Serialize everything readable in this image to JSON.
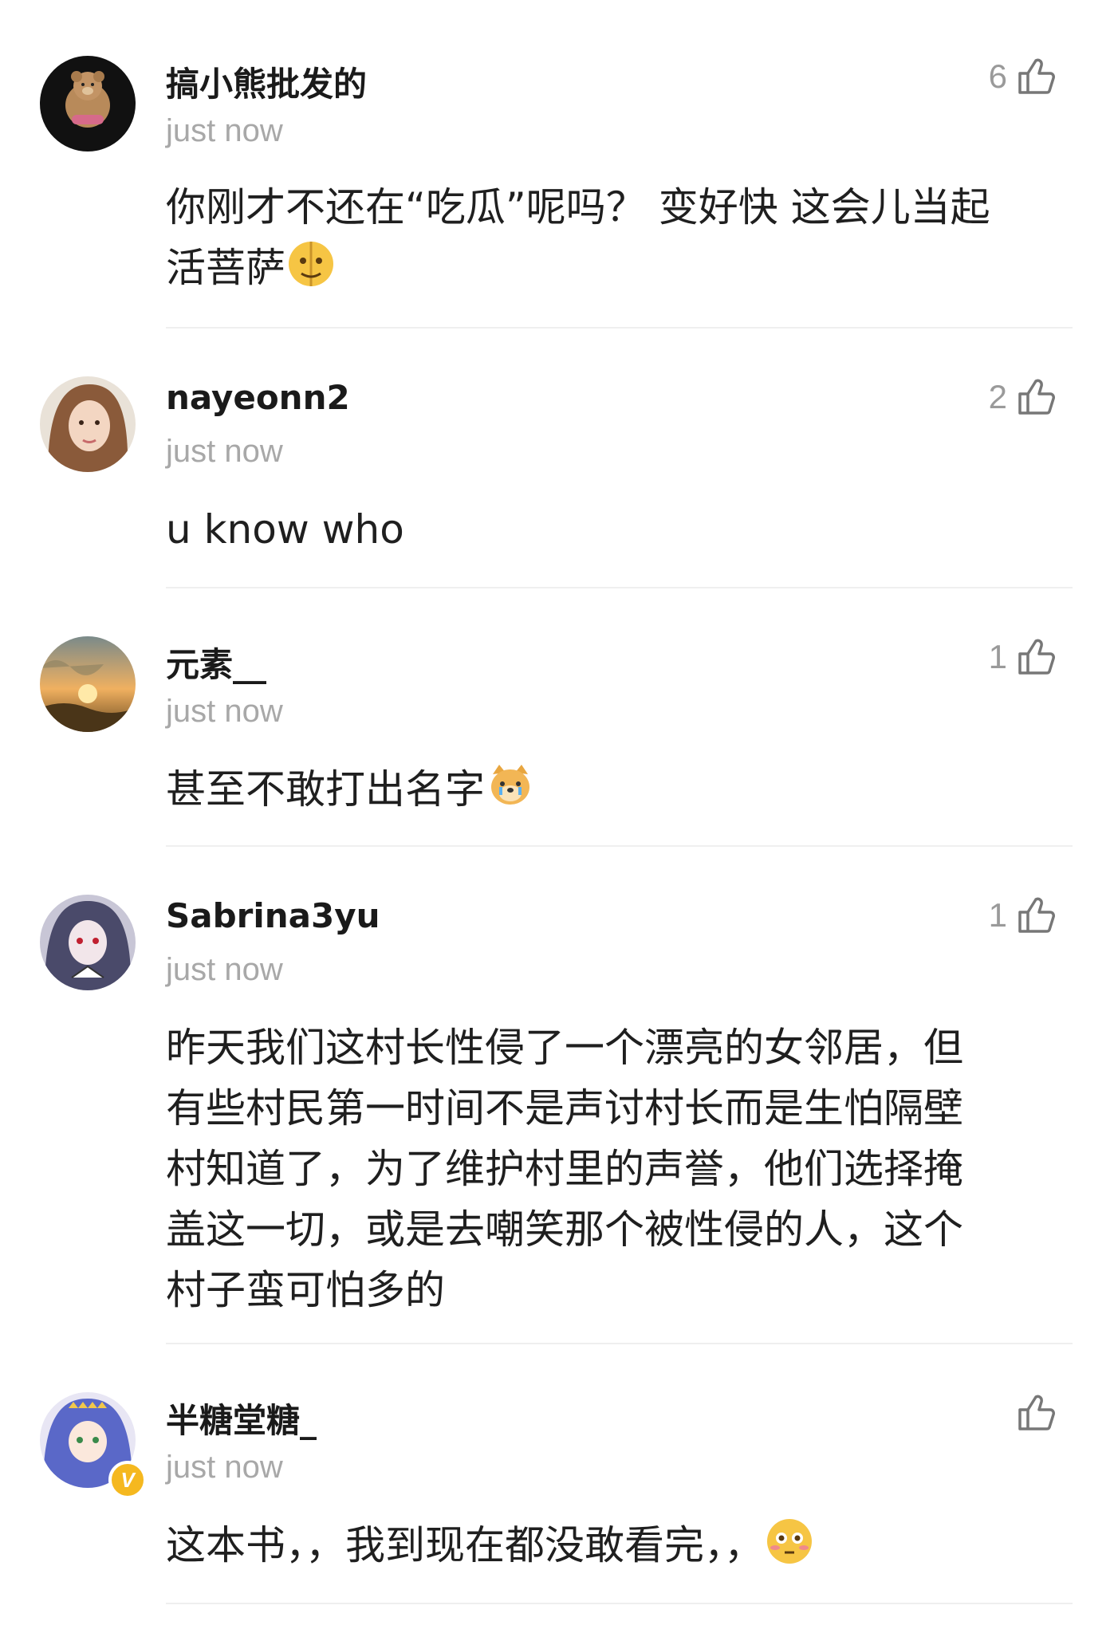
{
  "comments": [
    {
      "username": "搞小熊批发的",
      "time": "just now",
      "likes": "6",
      "text_lines": [
        "你刚才不还在“吃瓜”呢吗？ 变好快 这会儿当起",
        "活菩萨"
      ],
      "emoji": "split-face-emoji",
      "avatar": "teddy-bear-avatar"
    },
    {
      "username": "nayeonn2",
      "time": "just now",
      "likes": "2",
      "text_lines": [
        "u know who"
      ],
      "avatar": "girl-photo-avatar"
    },
    {
      "username": "元素__",
      "time": "just now",
      "likes": "1",
      "text_lines": [
        "甚至不敢打出名字"
      ],
      "emoji": "crying-doge-emoji",
      "avatar": "sunset-avatar"
    },
    {
      "username": "Sabrina3yu",
      "time": "just now",
      "likes": "1",
      "text_lines": [
        "昨天我们这村长性侵了一个漂亮的女邻居，但",
        "有些村民第一时间不是声讨村长而是生怕隔壁",
        "村知道了，为了维护村里的声誉，他们选择掩",
        "盖这一切，或是去嘲笑那个被性侵的人，这个",
        "村子蛮可怕多的"
      ],
      "avatar": "anime-girl-avatar"
    },
    {
      "username": "半糖堂糖_",
      "time": "just now",
      "likes": "",
      "text_lines": [
        "这本书，，我到现在都没敢看完，，"
      ],
      "emoji": "flushed-face-emoji",
      "avatar": "anime-blue-hair-avatar",
      "badge": "V"
    }
  ],
  "colors": {
    "background": "#ffffff",
    "username": "#1a1a1a",
    "time": "#a8a8a8",
    "like": "#9a9a9a",
    "divider": "#efefef"
  }
}
